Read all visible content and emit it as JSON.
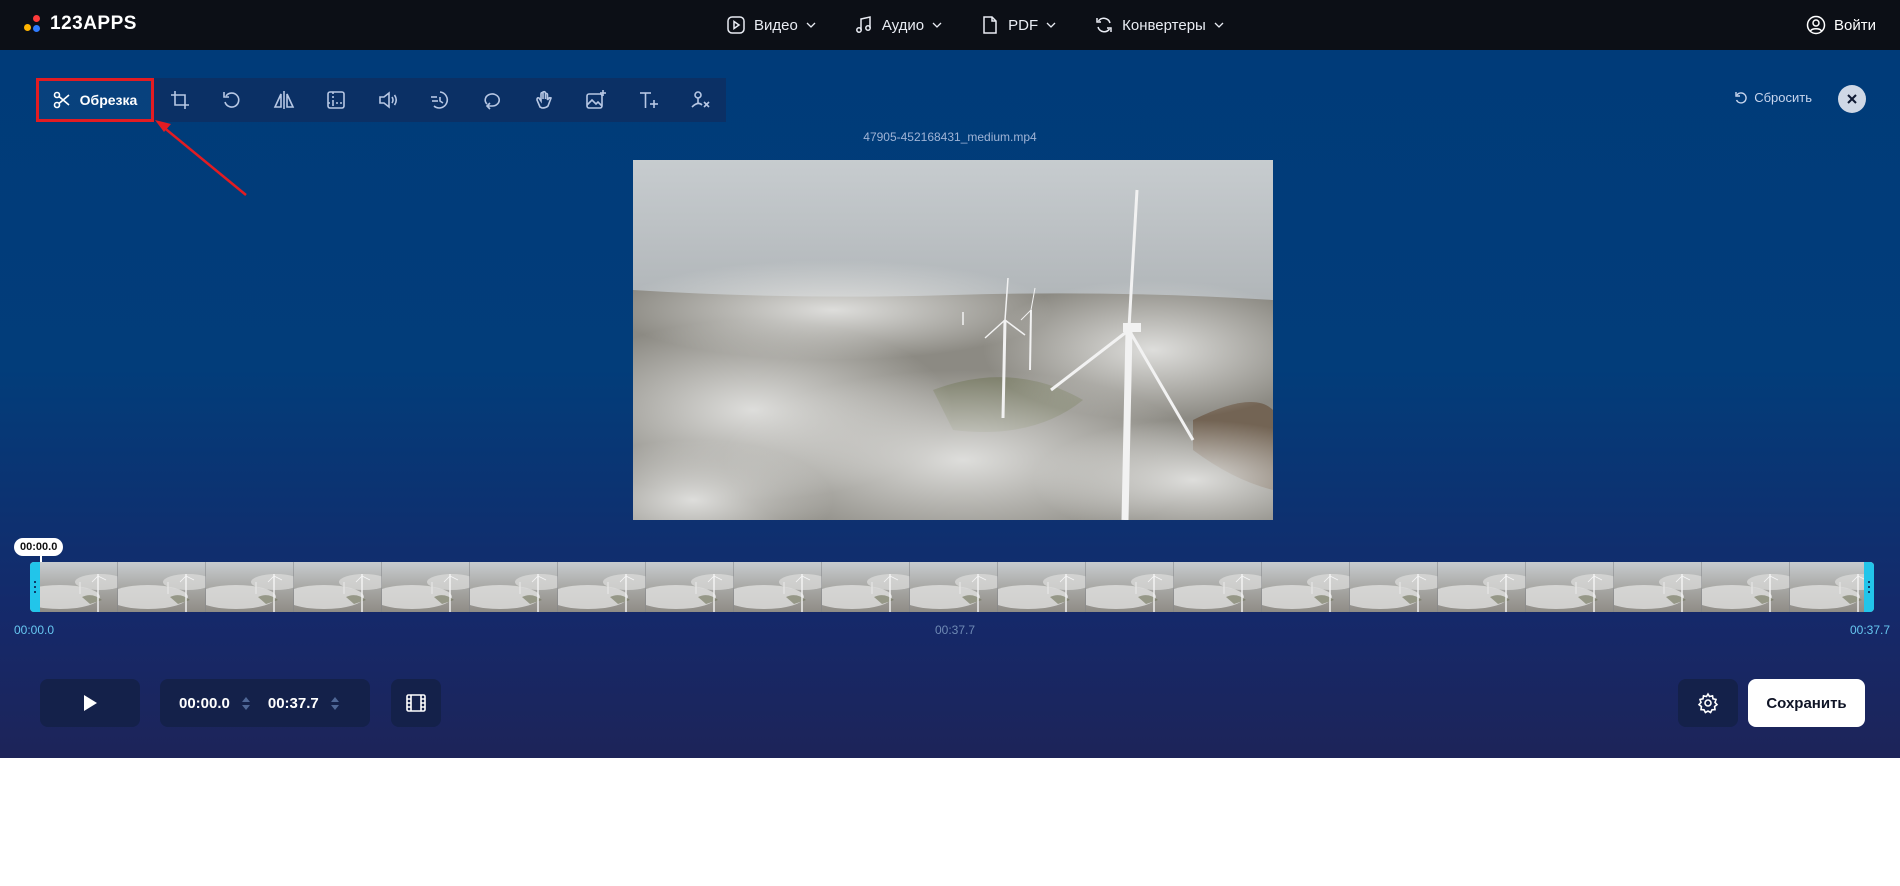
{
  "header": {
    "logo_text": "123APPS",
    "nav": [
      {
        "label": "Видео",
        "icon": "video-icon"
      },
      {
        "label": "Аудио",
        "icon": "music-icon"
      },
      {
        "label": "PDF",
        "icon": "document-icon"
      },
      {
        "label": "Конвертеры",
        "icon": "convert-icon"
      }
    ],
    "login_label": "Войти"
  },
  "toolbar": {
    "active_tool_label": "Обрезка",
    "tools": [
      "crop-icon",
      "rotate-icon",
      "flip-icon",
      "resize-icon",
      "volume-icon",
      "speed-icon",
      "loop-icon",
      "stabilize-icon",
      "add-image-icon",
      "add-text-icon",
      "remove-logo-icon"
    ],
    "reset_label": "Сбросить"
  },
  "video": {
    "filename": "47905-452168431_medium.mp4"
  },
  "timeline": {
    "playhead_time": "00:00.0",
    "start_time": "00:00.0",
    "middle_time": "00:37.7",
    "end_time": "00:37.7"
  },
  "controls": {
    "start_value": "00:00.0",
    "end_value": "00:37.7",
    "save_label": "Сохранить"
  },
  "colors": {
    "accent_handle": "#22c5ea",
    "highlight_border": "#e21c22"
  }
}
